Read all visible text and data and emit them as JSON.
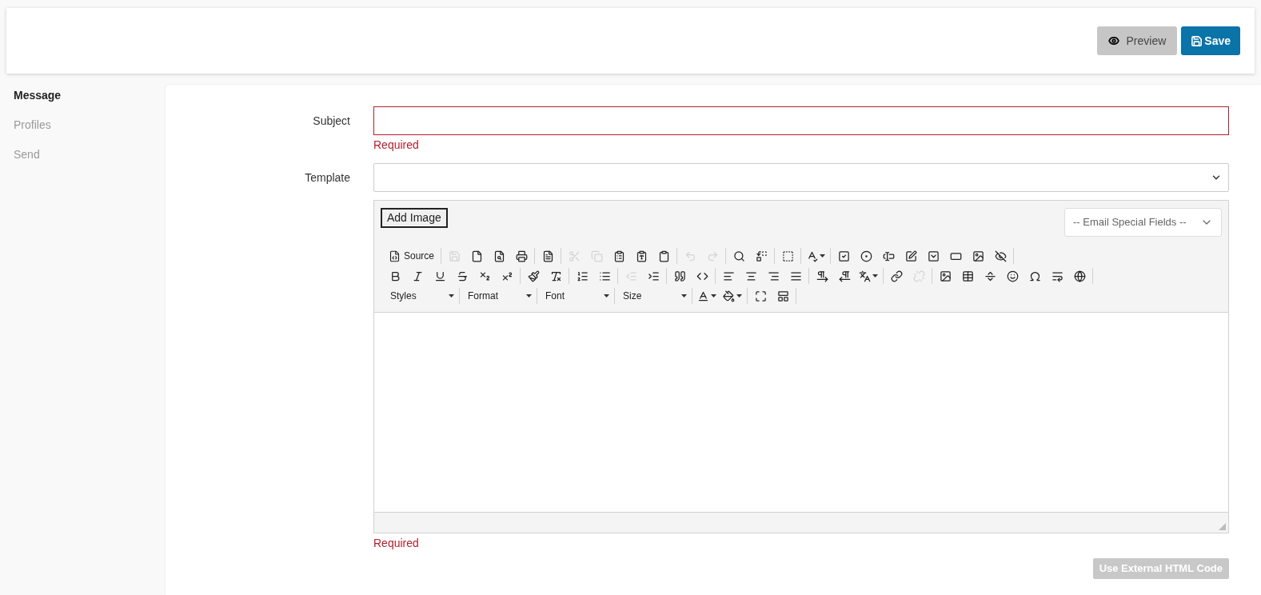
{
  "header": {
    "buttons": [
      {
        "label": "Preview",
        "kind": "preview"
      },
      {
        "label": "Save",
        "kind": "save"
      }
    ]
  },
  "sidebar": {
    "items": [
      {
        "label": "Message",
        "selected": true
      },
      {
        "label": "Profiles",
        "selected": false
      },
      {
        "label": "Send",
        "selected": false
      }
    ]
  },
  "form": {
    "subject": {
      "label": "Subject",
      "error": "Required"
    },
    "template": {
      "label": "Template"
    },
    "editor": {
      "add_image_button": "Add Image",
      "special_fields": {
        "placeholder": "-- Email Special Fields --"
      },
      "toolbar": [
        [
          [
            {
              "kind": "labeled",
              "label": "Source",
              "disabled": false
            }
          ],
          [
            {
              "kind": "button",
              "disabled": true
            },
            {
              "kind": "button",
              "disabled": false
            },
            {
              "kind": "button",
              "disabled": false
            },
            {
              "kind": "button",
              "disabled": false
            }
          ],
          [
            {
              "kind": "button",
              "disabled": false
            }
          ],
          [
            {
              "kind": "button",
              "disabled": true
            },
            {
              "kind": "button",
              "disabled": true
            },
            {
              "kind": "button",
              "disabled": false
            },
            {
              "kind": "button",
              "disabled": false
            },
            {
              "kind": "button",
              "disabled": false
            }
          ],
          [
            {
              "kind": "button",
              "disabled": true
            },
            {
              "kind": "button",
              "disabled": true
            }
          ],
          [
            {
              "kind": "button",
              "disabled": false
            },
            {
              "kind": "button",
              "disabled": false
            }
          ],
          [
            {
              "kind": "button",
              "disabled": false
            }
          ],
          [
            {
              "kind": "menu",
              "disabled": false
            }
          ],
          [
            {
              "kind": "button",
              "disabled": false
            },
            {
              "kind": "button",
              "disabled": false
            },
            {
              "kind": "button",
              "disabled": false
            },
            {
              "kind": "button",
              "disabled": false
            },
            {
              "kind": "button",
              "disabled": false
            },
            {
              "kind": "button",
              "disabled": false
            },
            {
              "kind": "button",
              "disabled": false
            },
            {
              "kind": "button",
              "disabled": false
            }
          ]
        ],
        [
          [
            {
              "kind": "button",
              "disabled": false
            },
            {
              "kind": "button",
              "disabled": false
            },
            {
              "kind": "button",
              "disabled": false
            },
            {
              "kind": "button",
              "disabled": false
            },
            {
              "kind": "button",
              "disabled": false
            },
            {
              "kind": "button",
              "disabled": false
            }
          ],
          [
            {
              "kind": "button",
              "disabled": false
            },
            {
              "kind": "button",
              "disabled": false
            }
          ],
          [
            {
              "kind": "button",
              "disabled": false
            },
            {
              "kind": "button",
              "disabled": false
            }
          ],
          [
            {
              "kind": "button",
              "disabled": true
            },
            {
              "kind": "button",
              "disabled": false
            }
          ],
          [
            {
              "kind": "button",
              "disabled": false
            },
            {
              "kind": "button",
              "disabled": false
            }
          ],
          [
            {
              "kind": "button",
              "disabled": false
            },
            {
              "kind": "button",
              "disabled": false
            },
            {
              "kind": "button",
              "disabled": false
            },
            {
              "kind": "button",
              "disabled": false
            }
          ],
          [
            {
              "kind": "button",
              "disabled": false
            },
            {
              "kind": "button",
              "disabled": false
            },
            {
              "kind": "menu",
              "disabled": false
            }
          ],
          [
            {
              "kind": "button",
              "disabled": false
            },
            {
              "kind": "button",
              "disabled": true
            }
          ],
          [
            {
              "kind": "button",
              "disabled": false
            },
            {
              "kind": "button",
              "disabled": false
            },
            {
              "kind": "button",
              "disabled": false
            },
            {
              "kind": "button",
              "disabled": false
            },
            {
              "kind": "button",
              "disabled": false
            },
            {
              "kind": "button",
              "disabled": false
            },
            {
              "kind": "button",
              "disabled": false
            }
          ]
        ],
        [
          [
            {
              "kind": "combo",
              "label": "Styles",
              "disabled": false
            }
          ],
          [
            {
              "kind": "combo",
              "label": "Format",
              "disabled": false
            }
          ],
          [
            {
              "kind": "combo",
              "label": "Font",
              "disabled": false
            }
          ],
          [
            {
              "kind": "combo",
              "label": "Size",
              "disabled": false
            }
          ],
          [
            {
              "kind": "menu",
              "disabled": false
            },
            {
              "kind": "menu",
              "disabled": false
            }
          ],
          [
            {
              "kind": "button",
              "disabled": false
            },
            {
              "kind": "button",
              "disabled": false
            }
          ]
        ]
      ],
      "error": "Required"
    },
    "external_html_button": {
      "label": "Use External HTML Code",
      "disabled": true
    }
  }
}
